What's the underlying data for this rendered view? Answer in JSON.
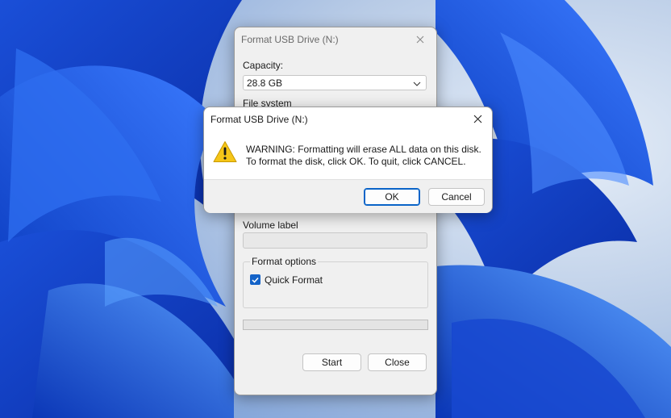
{
  "format_dialog": {
    "title": "Format USB Drive (N:)",
    "capacity_label": "Capacity:",
    "capacity_value": "28.8 GB",
    "file_system_label": "File system",
    "volume_label_label": "Volume label",
    "volume_label_value": "",
    "format_options_label": "Format options",
    "quick_format_label": "Quick Format",
    "quick_format_checked": true,
    "progress_fraction": 0,
    "start_label": "Start",
    "close_label": "Close"
  },
  "warning_dialog": {
    "title": "Format USB Drive (N:)",
    "message_line1": "WARNING: Formatting will erase ALL data on this disk.",
    "message_line2": "To format the disk, click OK. To quit, click CANCEL.",
    "ok_label": "OK",
    "cancel_label": "Cancel",
    "icon": "warning-icon"
  },
  "colors": {
    "accent": "#0a64c8",
    "warning_yellow": "#f5c518"
  }
}
